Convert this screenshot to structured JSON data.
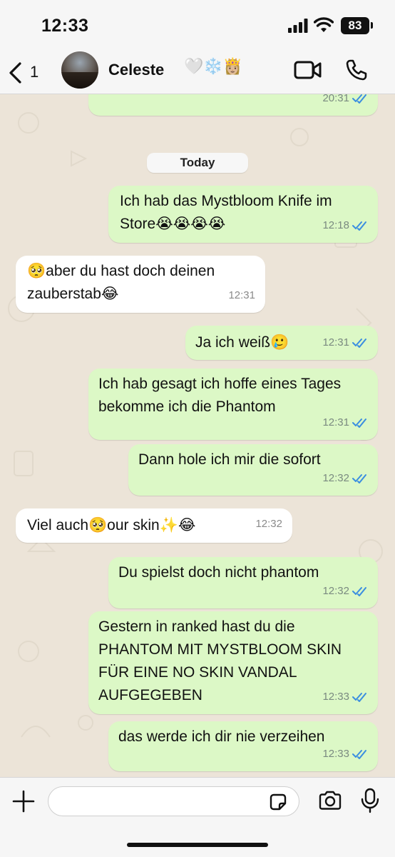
{
  "status_bar": {
    "time": "12:33",
    "battery": "83"
  },
  "header": {
    "back_count": "1",
    "contact_name": "Celeste",
    "contact_emoji": "🤍❄️👸🏼"
  },
  "chat": {
    "prev_time": "20:31",
    "date_label": "Today",
    "messages": [
      {
        "dir": "out",
        "text": "Ich hab das Mystbloom Knife im Store😭😭😭😭",
        "time": "12:18"
      },
      {
        "dir": "in",
        "text": "🥺aber du hast doch deinen zauberstab😂",
        "time": "12:31"
      },
      {
        "dir": "out",
        "text": "Ja ich weiß🥲",
        "time": "12:31"
      },
      {
        "dir": "out",
        "text": "Ich hab gesagt ich hoffe eines Tages bekomme ich die Phantom",
        "time": "12:31"
      },
      {
        "dir": "out",
        "text": "Dann hole ich mir die sofort",
        "time": "12:32"
      },
      {
        "dir": "in",
        "text": "Viel auch🥺our skin✨😂",
        "time": "12:32"
      },
      {
        "dir": "out",
        "text": "Du spielst doch nicht phantom",
        "time": "12:32"
      },
      {
        "dir": "out",
        "text": "Gestern in ranked hast du die PHANTOM MIT MYSTBLOOM SKIN FÜR EINE NO SKIN VANDAL AUFGEGEBEN",
        "time": "12:33"
      },
      {
        "dir": "out",
        "text": "das werde ich dir nie verzeihen",
        "time": "12:33"
      }
    ]
  },
  "composer": {
    "input_value": "",
    "placeholder": ""
  },
  "colors": {
    "outgoing_bubble": "#dcf8c6",
    "incoming_bubble": "#ffffff",
    "chat_bg": "#ece4d8",
    "read_ticks": "#3b8ee0"
  },
  "icons": [
    "back-chevron-icon",
    "video-call-icon",
    "phone-icon",
    "plus-icon",
    "sticker-icon",
    "camera-icon",
    "microphone-icon",
    "signal-icon",
    "wifi-icon",
    "read-ticks-icon"
  ]
}
